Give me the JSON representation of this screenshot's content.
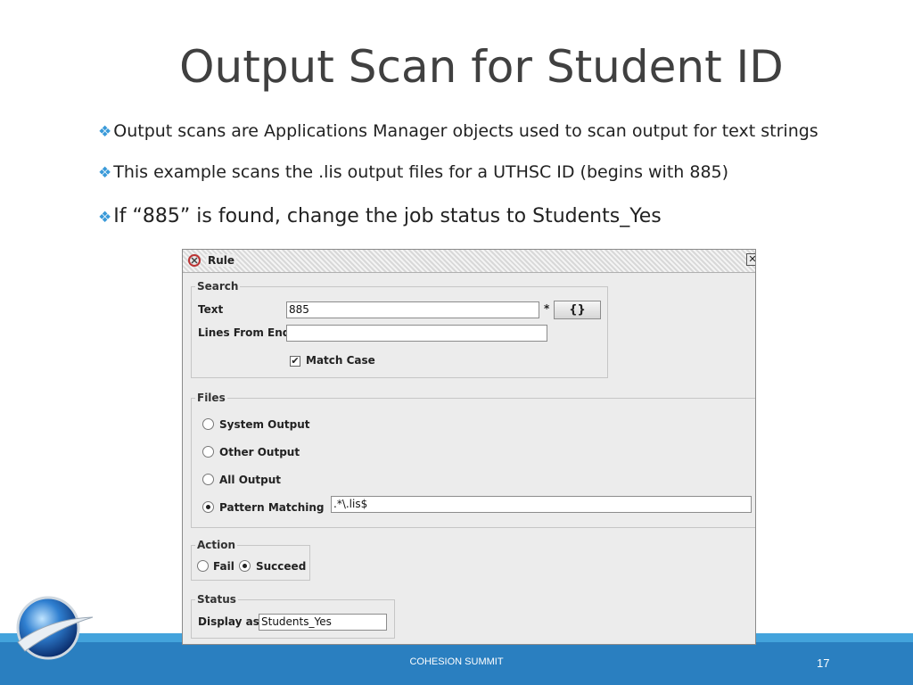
{
  "slide": {
    "title": "Output Scan for Student ID",
    "bullets": [
      "Output scans are Applications Manager objects used to scan output for text strings",
      "This example scans the .lis output files for a UTHSC ID (begins with 885)",
      "If “885” is found, change the job status to Students_Yes"
    ],
    "bullet_glyph": "❖",
    "footer_text": "COHESION SUMMIT",
    "page_number": "17"
  },
  "dialog": {
    "title": "Rule",
    "close_glyph": "✕",
    "search": {
      "group_label": "Search",
      "text_label": "Text",
      "text_value": "885",
      "required_mark": "*",
      "braces_button": "{}",
      "lines_label": "Lines From End",
      "lines_value": "",
      "match_case_label": "Match Case",
      "match_case_checked": true,
      "check_glyph": "✔"
    },
    "files": {
      "group_label": "Files",
      "options": [
        "System Output",
        "Other Output",
        "All Output",
        "Pattern Matching"
      ],
      "selected": "Pattern Matching",
      "pattern_value": ".*\\.lis$"
    },
    "action": {
      "group_label": "Action",
      "options": [
        "Fail",
        "Succeed"
      ],
      "selected": "Succeed"
    },
    "status": {
      "group_label": "Status",
      "display_label": "Display as",
      "display_value": "Students_Yes"
    }
  },
  "colors": {
    "accent": "#3a9ad9",
    "footer": "#2a7fc0",
    "footer_band": "#43a3dc",
    "title_text": "#404040"
  }
}
